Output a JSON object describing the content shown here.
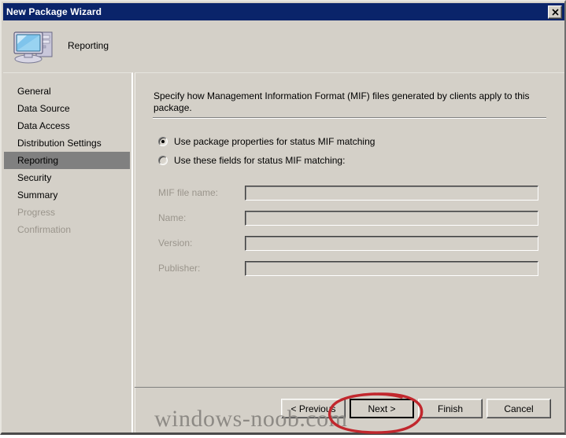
{
  "window": {
    "title": "New Package Wizard",
    "close_label": "✕"
  },
  "header": {
    "icon": "computer-icon",
    "title": "Reporting"
  },
  "sidebar": {
    "items": [
      {
        "label": "General",
        "state": "normal"
      },
      {
        "label": "Data Source",
        "state": "normal"
      },
      {
        "label": "Data Access",
        "state": "normal"
      },
      {
        "label": "Distribution Settings",
        "state": "normal"
      },
      {
        "label": "Reporting",
        "state": "selected"
      },
      {
        "label": "Security",
        "state": "normal"
      },
      {
        "label": "Summary",
        "state": "normal"
      },
      {
        "label": "Progress",
        "state": "disabled"
      },
      {
        "label": "Confirmation",
        "state": "disabled"
      }
    ]
  },
  "content": {
    "intro": "Specify how Management Information Format (MIF) files generated by clients apply to this package.",
    "radio_options": [
      {
        "label": "Use package properties for status MIF matching",
        "selected": true
      },
      {
        "label": "Use these fields for status MIF matching:",
        "selected": false
      }
    ],
    "fields": [
      {
        "label": "MIF file name:",
        "value": "",
        "placeholder": "",
        "disabled": true
      },
      {
        "label": "Name:",
        "value": "",
        "placeholder": "",
        "disabled": true
      },
      {
        "label": "Version:",
        "value": "",
        "placeholder": "",
        "disabled": true
      },
      {
        "label": "Publisher:",
        "value": "",
        "placeholder": "",
        "disabled": true
      }
    ]
  },
  "buttons": [
    {
      "label": "< Previous",
      "focused": false
    },
    {
      "label": "Next >",
      "focused": true
    },
    {
      "label": "Finish",
      "focused": false
    },
    {
      "label": "Cancel",
      "focused": false
    }
  ],
  "watermark": {
    "text": "windows-noob.com"
  },
  "annotation": {
    "color": "#c1272d",
    "shape": "hand-drawn-ellipse",
    "target": "Next >"
  },
  "colors": {
    "titlebar": "#0a246a",
    "dialog_face": "#d4d0c8",
    "selection": "#808080",
    "disabled_text": "#9a958c",
    "annotation_red": "#c1272d"
  }
}
